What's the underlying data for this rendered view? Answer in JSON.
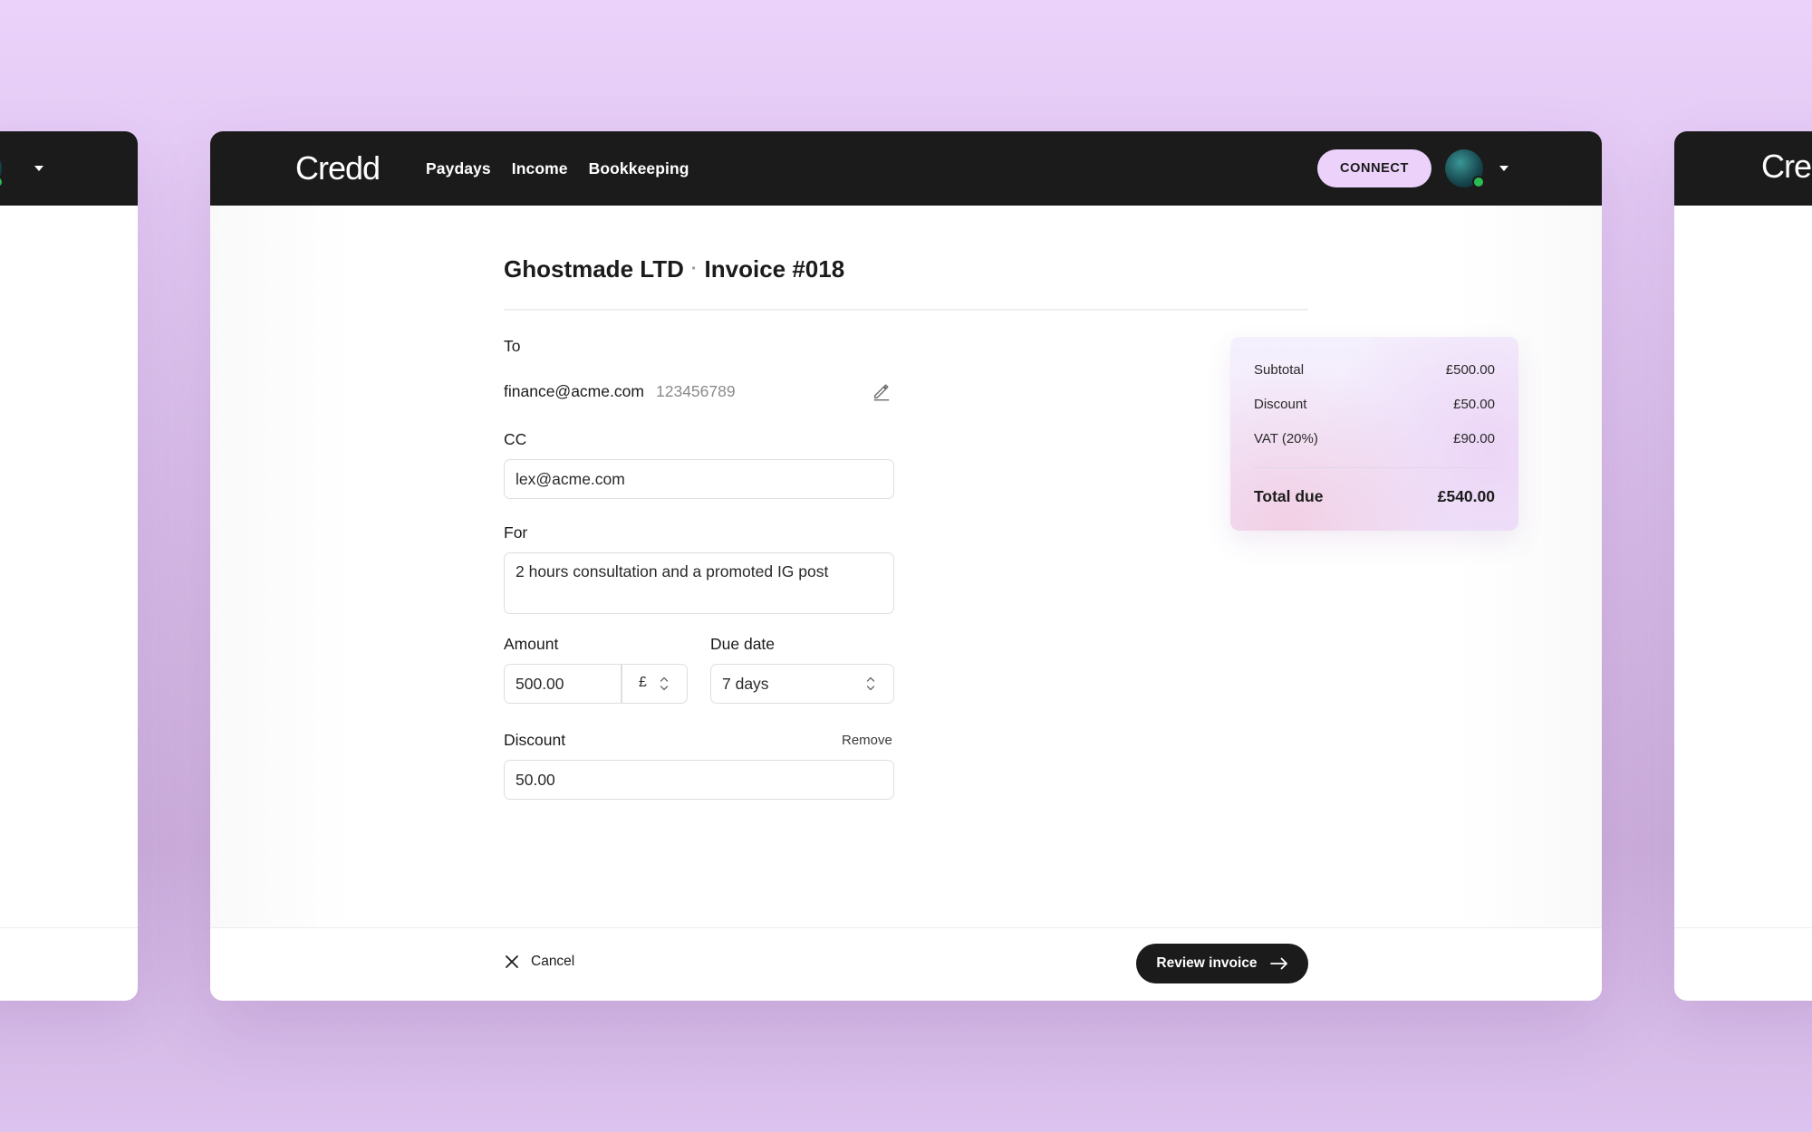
{
  "app": {
    "logo": "Credd",
    "logo_partial": "Cre"
  },
  "nav": {
    "items": [
      "Paydays",
      "Income",
      "Bookkeeping"
    ],
    "connect_label": "CONNECT"
  },
  "page": {
    "client": "Ghostmade LTD",
    "separator": "·",
    "invoice_label": "Invoice #018"
  },
  "form": {
    "to_label": "To",
    "to_email": "finance@acme.com",
    "to_phone": "123456789",
    "cc_label": "CC",
    "cc_value": "lex@acme.com",
    "for_label": "For",
    "for_value": "2 hours consultation and a promoted IG post",
    "amount_label": "Amount",
    "amount_value": "500.00",
    "currency": "£",
    "due_label": "Due date",
    "due_value": "7 days",
    "discount_label": "Discount",
    "remove_label": "Remove",
    "discount_value": "50.00"
  },
  "summary": {
    "subtotal_label": "Subtotal",
    "subtotal_value": "£500.00",
    "discount_label": "Discount",
    "discount_value": "£50.00",
    "vat_label": "VAT (20%)",
    "vat_value": "£90.00",
    "total_label": "Total due",
    "total_value": "£540.00"
  },
  "footer": {
    "cancel_label": "Cancel",
    "review_label": "Review invoice"
  },
  "colors": {
    "accent": "#ecd1fb",
    "topbar": "#1b1b1b",
    "online": "#2bbd52"
  },
  "icons": [
    "pencil-icon",
    "close-icon",
    "arrow-right-icon",
    "chevron-up-down-icon",
    "caret-down-icon"
  ]
}
